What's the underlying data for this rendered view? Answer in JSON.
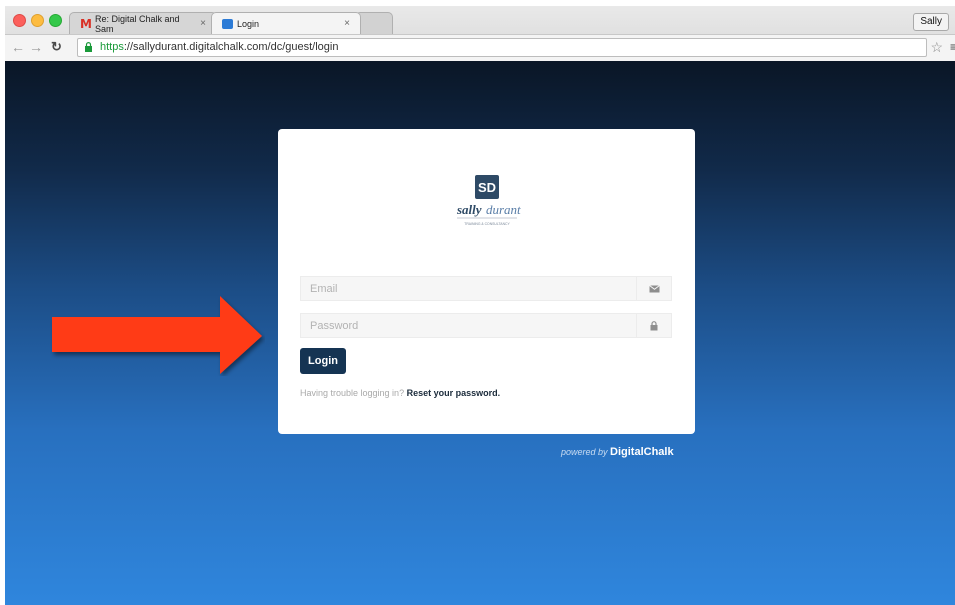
{
  "browser": {
    "tabs": [
      {
        "title": "Re: Digital Chalk and Sam",
        "close": "×"
      },
      {
        "title": "Login",
        "close": "×"
      }
    ],
    "profile_label": "Sally",
    "url_scheme": "https",
    "url_rest": "://sallydurant.digitalchalk.com/dc/guest/login"
  },
  "logo": {
    "monogram": "SD",
    "brand_first": "sally",
    "brand_second": "durant",
    "tagline": "TRAINING & CONSULTANCY"
  },
  "form": {
    "email_placeholder": "Email",
    "password_placeholder": "Password",
    "login_label": "Login",
    "help_text": "Having trouble logging in? ",
    "reset_link": "Reset your password."
  },
  "footer": {
    "powered_prefix": "powered by ",
    "powered_brand": "DigitalChalk"
  },
  "colors": {
    "button": "#153453",
    "arrow": "#ff3a12",
    "gradient_top": "#0a1626",
    "gradient_bottom": "#2f86dd"
  }
}
